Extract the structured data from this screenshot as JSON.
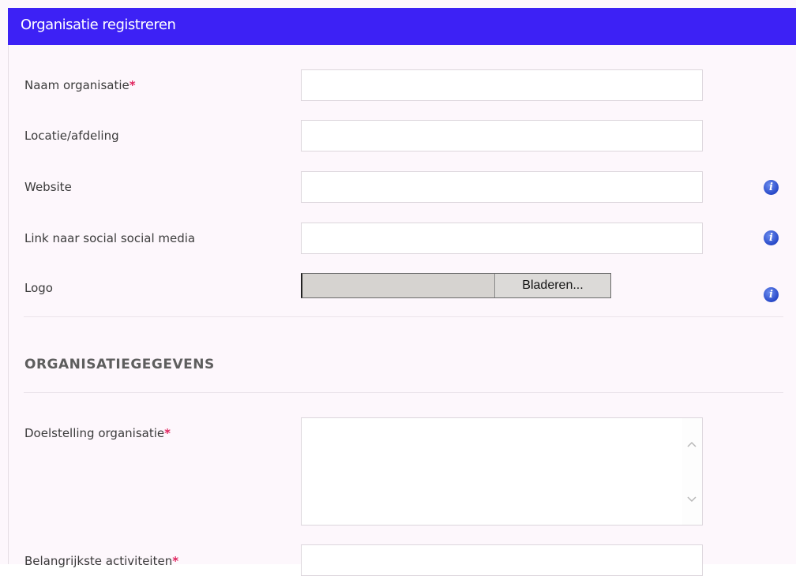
{
  "header": {
    "title": "Organisatie registreren"
  },
  "fields": {
    "naam": {
      "label": "Naam organisatie",
      "required": "*",
      "value": ""
    },
    "locatie": {
      "label": "Locatie/afdeling",
      "value": ""
    },
    "website": {
      "label": "Website",
      "value": ""
    },
    "social": {
      "label": "Link naar social social media",
      "value": ""
    },
    "logo": {
      "label": "Logo",
      "browse_label": "Bladeren..."
    }
  },
  "section": {
    "title": "ORGANISATIEGEGEVENS"
  },
  "details": {
    "doelstelling": {
      "label": "Doelstelling organisatie",
      "required": "*",
      "value": ""
    },
    "activiteiten": {
      "label": "Belangrijkste activiteiten",
      "required": "*"
    }
  },
  "icons": {
    "info": "info-icon",
    "scroll_up": "chevron-up-icon",
    "scroll_down": "chevron-down-icon"
  },
  "colors": {
    "header_bg": "#3d21f5",
    "required": "#e0245e",
    "info": "#2748c8"
  }
}
